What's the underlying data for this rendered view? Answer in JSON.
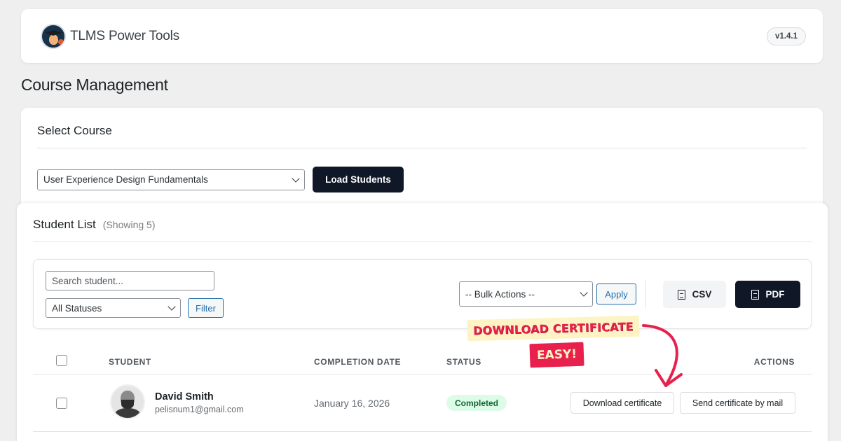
{
  "header": {
    "brand_name": "TLMS Power Tools",
    "version": "v1.4.1"
  },
  "page_title": "Course Management",
  "select_course": {
    "title": "Select Course",
    "selected_course": "User Experience Design Fundamentals",
    "load_button": "Load Students"
  },
  "student_list": {
    "title": "Student List",
    "count_label": "(Showing 5)",
    "search_placeholder": "Search student...",
    "status_filter": "All Statuses",
    "filter_button": "Filter",
    "bulk_actions": "-- Bulk Actions --",
    "apply_button": "Apply",
    "csv_button": "CSV",
    "pdf_button": "PDF",
    "columns": {
      "student": "STUDENT",
      "completion_date": "COMPLETION DATE",
      "status": "STATUS",
      "actions": "ACTIONS"
    },
    "rows": [
      {
        "name": "David Smith",
        "email": "pelisnum1@gmail.com",
        "completion_date": "January 16, 2026",
        "status": "Completed",
        "download_label": "Download certificate",
        "mail_label": "Send certificate by mail"
      }
    ]
  },
  "annotation": {
    "line1": "DOWNLOAD CERTIFICATE",
    "line2": "EASY!"
  },
  "colors": {
    "primary_dark": "#101828",
    "link_blue": "#2271b1",
    "status_completed_bg": "#dcfce7",
    "status_completed_text": "#166534",
    "annotation_red": "#e8204d",
    "annotation_cream": "#fdf3c4"
  }
}
